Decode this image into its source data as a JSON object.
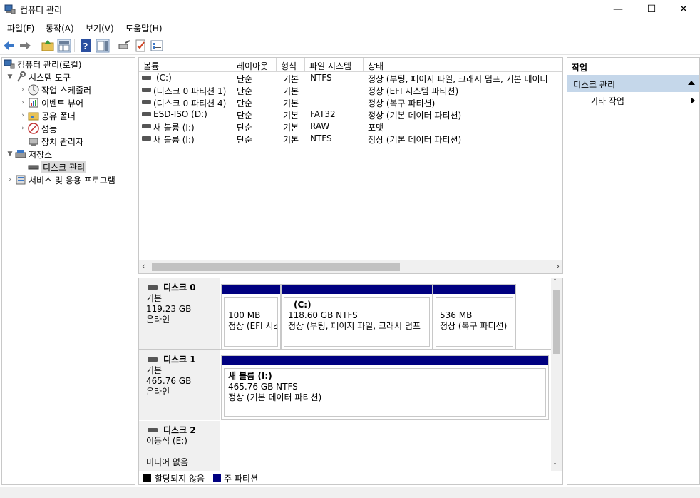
{
  "window": {
    "title": "컴퓨터 관리",
    "minimize_glyph": "—",
    "maximize_glyph": "☐",
    "close_glyph": "✕"
  },
  "menu": [
    "파일(F)",
    "동작(A)",
    "보기(V)",
    "도움말(H)"
  ],
  "toolbar": {
    "icons": [
      "back-icon",
      "forward-icon",
      "up-folder-icon",
      "show-tree-icon",
      "help-icon",
      "show-action-pane-icon",
      "connect-icon",
      "check-icon",
      "properties-icon"
    ]
  },
  "tree": [
    {
      "label": "컴퓨터 관리(로컬)",
      "icon": "computer-management-icon"
    },
    {
      "label": "시스템 도구",
      "icon": "system-tools-icon"
    },
    {
      "label": "작업 스케줄러",
      "icon": "task-scheduler-icon"
    },
    {
      "label": "이벤트 뷰어",
      "icon": "event-viewer-icon"
    },
    {
      "label": "공유 폴더",
      "icon": "shared-folders-icon"
    },
    {
      "label": "성능",
      "icon": "performance-icon"
    },
    {
      "label": "장치 관리자",
      "icon": "device-manager-icon"
    },
    {
      "label": "저장소",
      "icon": "storage-icon"
    },
    {
      "label": "디스크 관리",
      "icon": "disk-management-icon"
    },
    {
      "label": "서비스 및 응용 프로그램",
      "icon": "services-apps-icon"
    }
  ],
  "volume_list": {
    "columns": [
      "볼륨",
      "레이아웃",
      "형식",
      "파일 시스템",
      "상태"
    ],
    "rows": [
      {
        "volume": "(C:)",
        "layout": "단순",
        "type": "기본",
        "fs": "NTFS",
        "status": "정상 (부팅, 페이지 파일, 크래시 덤프, 기본 데이터"
      },
      {
        "volume": "(디스크 0 파티션 1)",
        "layout": "단순",
        "type": "기본",
        "fs": "",
        "status": "정상 (EFI 시스템 파티션)"
      },
      {
        "volume": "(디스크 0 파티션 4)",
        "layout": "단순",
        "type": "기본",
        "fs": "",
        "status": "정상 (복구 파티션)"
      },
      {
        "volume": "ESD-ISO (D:)",
        "layout": "단순",
        "type": "기본",
        "fs": "FAT32",
        "status": "정상 (기본 데이터 파티션)"
      },
      {
        "volume": "새 볼륨 (I:)",
        "layout": "단순",
        "type": "기본",
        "fs": "RAW",
        "status": "포맷"
      },
      {
        "volume": "새 볼륨 (I:)",
        "layout": "단순",
        "type": "기본",
        "fs": "NTFS",
        "status": "정상 (기본 데이터 파티션)"
      }
    ]
  },
  "disks": [
    {
      "name": "디스크 0",
      "kind": "기본",
      "size": "119.23 GB",
      "state": "온라인",
      "partitions": [
        {
          "title": "",
          "size": "100 MB",
          "status": "정상 (EFI 시스"
        },
        {
          "title": "(C:)",
          "size": "118.60 GB NTFS",
          "status": "정상 (부팅, 페이지 파일, 크래시 덤프"
        },
        {
          "title": "",
          "size": "536 MB",
          "status": "정상 (복구 파티션)"
        }
      ]
    },
    {
      "name": "디스크 1",
      "kind": "기본",
      "size": "465.76 GB",
      "state": "온라인",
      "partitions": [
        {
          "title": "새 볼륨  (I:)",
          "size": "465.76 GB NTFS",
          "status": "정상 (기본 데이터 파티션)"
        }
      ]
    },
    {
      "name": "디스크 2",
      "kind": "이동식 (E:)",
      "size": "",
      "state": "미디어 없음",
      "partitions": []
    }
  ],
  "legend": [
    {
      "label": "할당되지 않음",
      "color": "#000000"
    },
    {
      "label": "주 파티션",
      "color": "#000080"
    }
  ],
  "actions": {
    "header": "작업",
    "section": "디스크 관리",
    "item": "기타 작업"
  },
  "colors": {
    "partition_bar": "#000080",
    "action_section_bg": "#c5d7ea",
    "selection_bg": "#dadada"
  }
}
